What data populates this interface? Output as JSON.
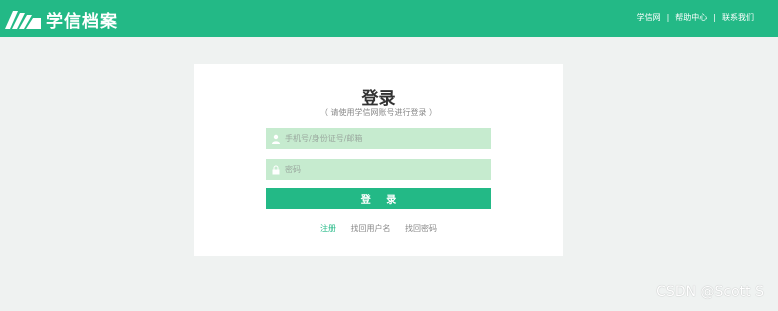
{
  "header": {
    "logo_text": "学信档案",
    "nav": [
      "学信网",
      "帮助中心",
      "联系我们"
    ],
    "separator": "|"
  },
  "login": {
    "title": "登录",
    "subtitle": "（ 请使用学信网账号进行登录 ）",
    "username_placeholder": "手机号/身份证号/邮箱",
    "username_value": "",
    "password_placeholder": "密码",
    "password_value": "",
    "submit_label": "登 录",
    "links": {
      "register": "注册",
      "find_username": "找回用户名",
      "find_password": "找回密码"
    }
  },
  "watermark": "CSDN @Scott S",
  "colors": {
    "brand": "#23b986",
    "input_bg": "#c6ebcf",
    "page_bg": "#eff2f1"
  }
}
